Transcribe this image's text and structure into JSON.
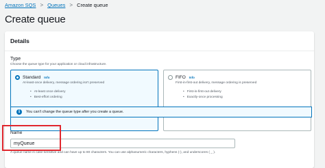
{
  "breadcrumb": {
    "items": [
      "Amazon SQS",
      "Queues",
      "Create queue"
    ],
    "separator": ">"
  },
  "page_title": "Create queue",
  "details": {
    "title": "Details",
    "type_label": "Type",
    "type_description": "Choose the queue type for your application or cloud infrastructure.",
    "options": [
      {
        "title": "Standard",
        "info": "Info",
        "selected": true,
        "description": "At-least-once delivery, message ordering isn't preserved",
        "bullets": [
          "At-least once delivery",
          "Best-effort ordering"
        ]
      },
      {
        "title": "FIFO",
        "info": "Info",
        "selected": false,
        "description": "First-in-first-out delivery, message ordering is preserved",
        "bullets": [
          "First-in-first-out delivery",
          "Exactly-once processing"
        ]
      }
    ],
    "alert": {
      "icon": "info-icon",
      "text": "You can't change the queue type after you create a queue."
    },
    "name_label": "Name",
    "name_value": "myQueue",
    "name_hint": "A queue name is case-sensitive and can have up to 80 characters. You can use alphanumeric characters, hyphens (-), and underscores ( _ )."
  },
  "colors": {
    "link": "#0073bb",
    "selected_border": "#0073bb",
    "highlight": "#e0262d"
  }
}
